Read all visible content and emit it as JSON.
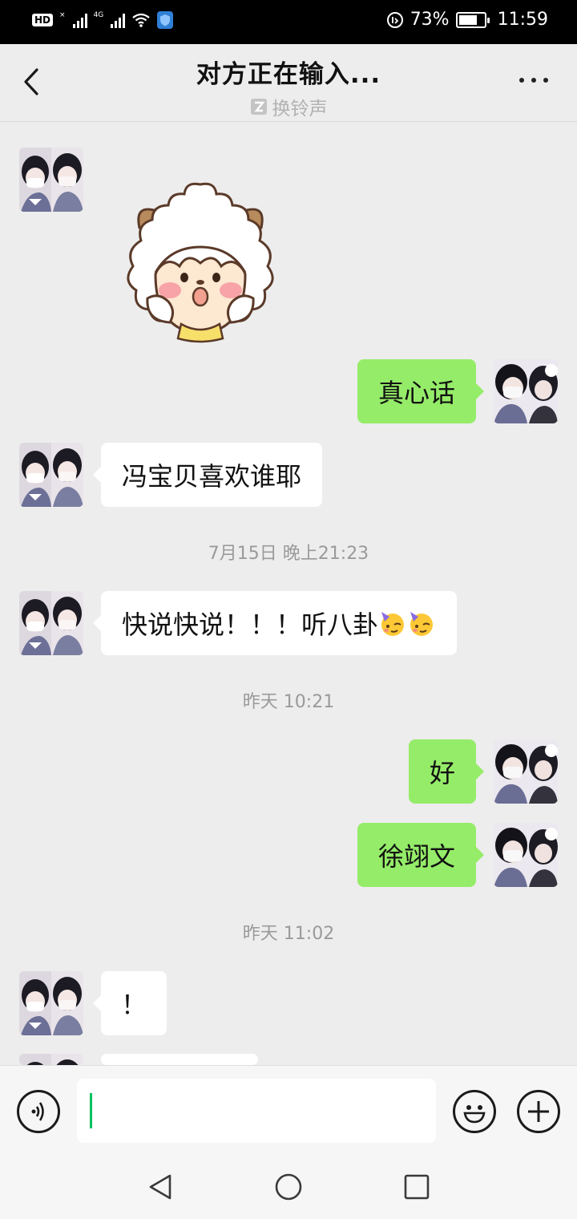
{
  "status_bar": {
    "hd_badge": "HD",
    "signal_label_1": "×",
    "signal_label_2": "4G",
    "battery_percent": "73%",
    "battery_level": 0.73,
    "time": "11:59"
  },
  "header": {
    "title": "对方正在输入...",
    "subtitle": "换铃声"
  },
  "messages": [
    {
      "side": "left",
      "type": "sticker",
      "sticker_name": "lazy-sheep-sticker"
    },
    {
      "side": "right",
      "type": "text",
      "text": "真心话"
    },
    {
      "side": "left",
      "type": "text",
      "text": "冯宝贝喜欢谁耶"
    },
    {
      "type": "timestamp",
      "text": "7月15日 晚上21:23"
    },
    {
      "side": "left",
      "type": "text",
      "text": "快说快说！！！听八卦",
      "emoji": [
        "partying-face-icon",
        "partying-face-icon"
      ]
    },
    {
      "type": "timestamp",
      "text": "昨天 10:21"
    },
    {
      "side": "right",
      "type": "text",
      "text": "好"
    },
    {
      "side": "right",
      "type": "text",
      "text": "徐翊文"
    },
    {
      "type": "timestamp",
      "text": "昨天 11:02"
    },
    {
      "side": "left",
      "type": "text",
      "text": "！"
    }
  ],
  "input_bar": {
    "voice_icon": "voice-icon",
    "input_value": "",
    "emoji_icon": "smiley-icon",
    "plus_icon": "plus-icon"
  },
  "colors": {
    "outgoing_bubble": "#95ec69",
    "incoming_bubble": "#ffffff",
    "background": "#ededed",
    "caret": "#07c160"
  }
}
